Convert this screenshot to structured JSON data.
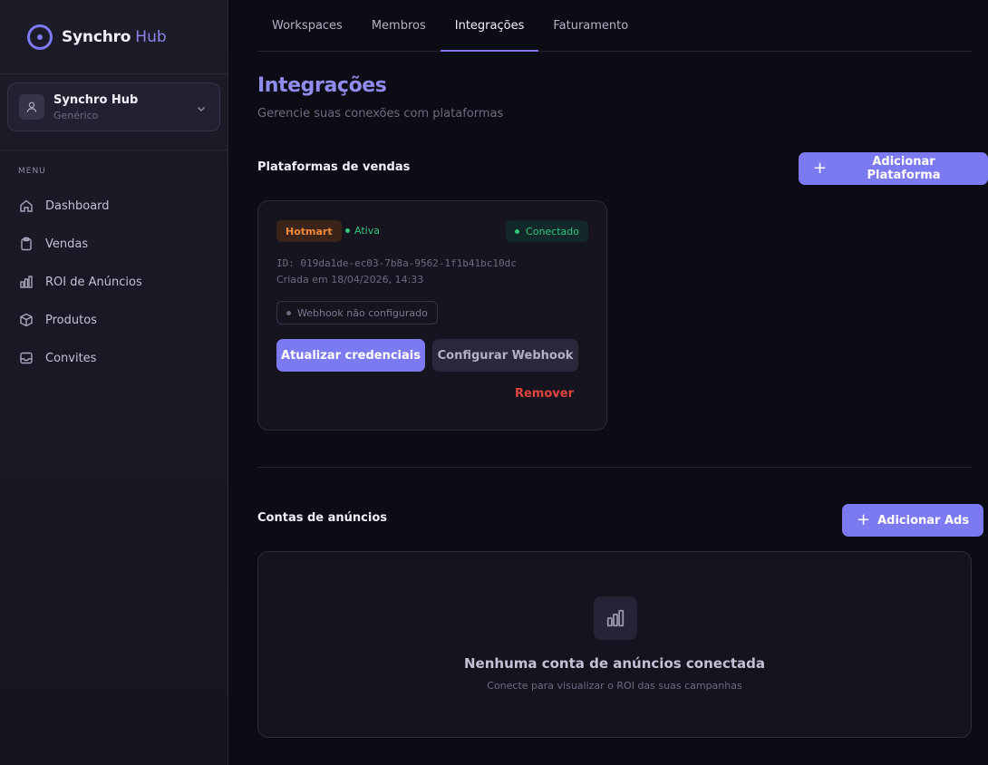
{
  "brand": {
    "name": "Synchro",
    "suffix": "Hub"
  },
  "workspace": {
    "name": "Synchro Hub",
    "type": "Genérico"
  },
  "menu": {
    "label": "MENU",
    "items": [
      {
        "label": "Dashboard",
        "icon": "home-icon"
      },
      {
        "label": "Vendas",
        "icon": "clipboard-icon"
      },
      {
        "label": "ROI de Anúncios",
        "icon": "bar-chart-icon"
      },
      {
        "label": "Produtos",
        "icon": "box-icon"
      },
      {
        "label": "Convites",
        "icon": "inbox-icon"
      }
    ]
  },
  "tabs": [
    "Workspaces",
    "Membros",
    "Integrações",
    "Faturamento"
  ],
  "active_tab": "Integrações",
  "page": {
    "title": "Integrações",
    "subtitle": "Gerencie suas conexões com plataformas"
  },
  "sales": {
    "title": "Plataformas de vendas",
    "add_label": "Adicionar Plataforma",
    "card": {
      "platform": "Hotmart",
      "status": "Ativa",
      "connection": "Conectado",
      "id": "ID: 019da1de-ec03-7b8a-9562-1f1b41bc10dc",
      "created": "Criada em 18/04/2026, 14:33",
      "webhook": "Webhook não configurado",
      "update_label": "Atualizar credenciais",
      "webhook_label": "Configurar Webhook",
      "remove_label": "Remover"
    }
  },
  "ads": {
    "title": "Contas de anúncios",
    "add_label": "Adicionar Ads",
    "empty_title": "Nenhuma conta de anúncios conectada",
    "empty_subtitle": "Conecte para visualizar o ROI das suas campanhas"
  },
  "colors": {
    "accent": "#7b7af0",
    "hotmart": "#f08a3a",
    "success": "#34c77b",
    "danger": "#e0443e"
  }
}
